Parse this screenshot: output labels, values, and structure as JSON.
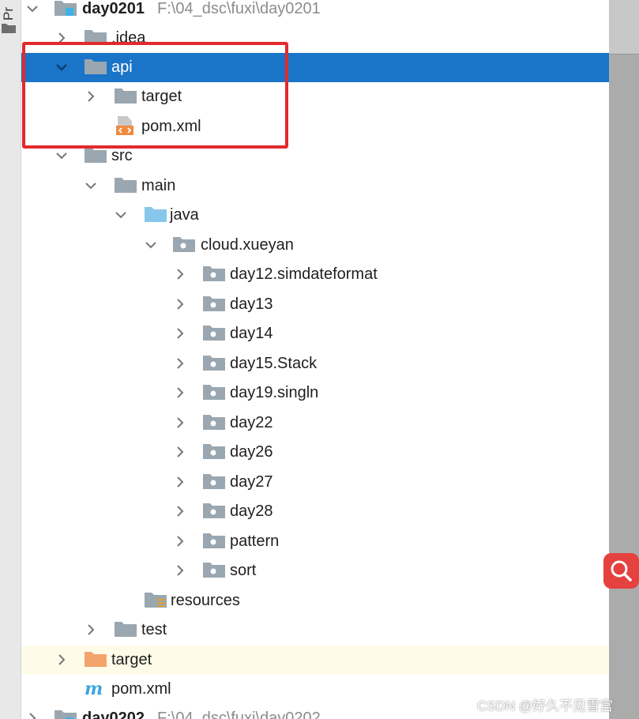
{
  "side_strip": {
    "label": "Pr"
  },
  "tree": {
    "module_top": {
      "name": "day0201",
      "path": "F:\\04_dsc\\fuxi\\day0201"
    },
    "idea": ".idea",
    "api": {
      "name": "api",
      "target": "target",
      "pom": "pom.xml"
    },
    "src": "src",
    "main": "main",
    "java": "java",
    "package": "cloud.xueyan",
    "subpackages": [
      "day12.simdateformat",
      "day13",
      "day14",
      "day15.Stack",
      "day19.singln",
      "day22",
      "day26",
      "day27",
      "day28",
      "pattern",
      "sort"
    ],
    "resources": "resources",
    "test": "test",
    "target": "target",
    "pom": "pom.xml",
    "module_bottom": {
      "name": "day0202",
      "path": "F:\\04_dsc\\fuxi\\day0202"
    }
  },
  "watermark": "CSDN @好久不见雪宫",
  "colors": {
    "selection": "#1a74c7",
    "highlight_row": "#fefce9",
    "red_annotation": "#e22a2d",
    "search_button": "#e5413f"
  }
}
